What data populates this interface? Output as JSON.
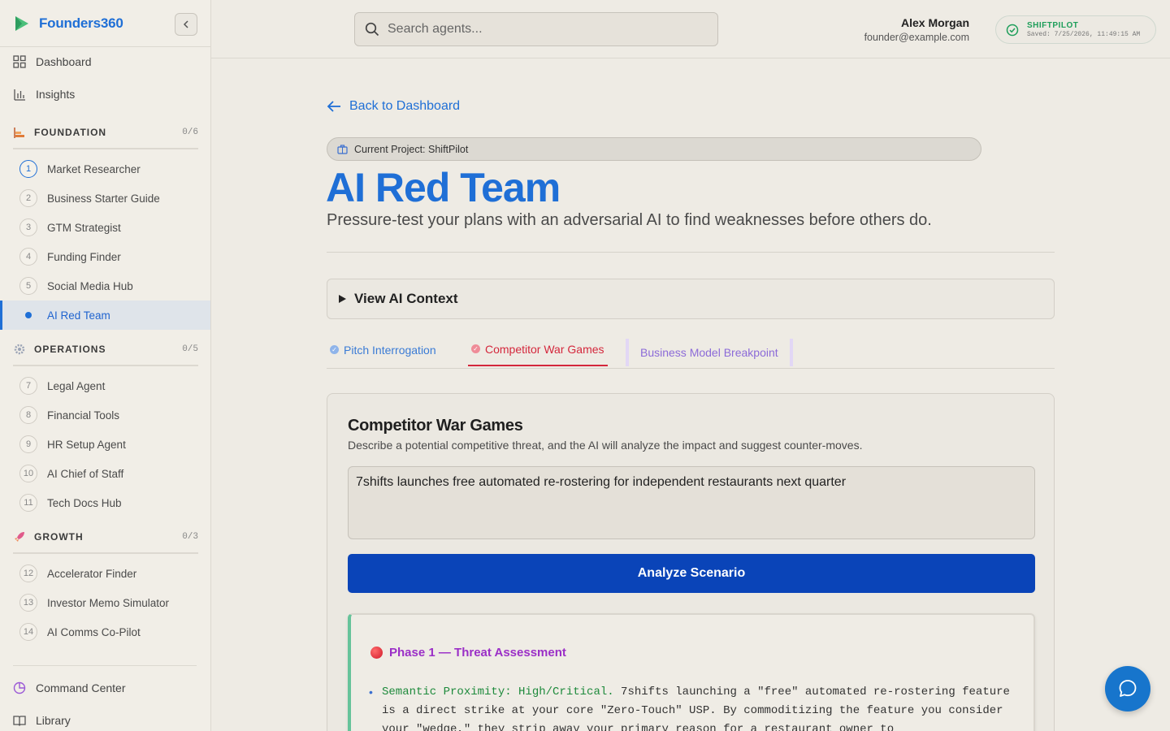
{
  "brand": {
    "name": "Founders360"
  },
  "nav_top": [
    {
      "label": "Dashboard",
      "icon": "grid-icon"
    },
    {
      "label": "Insights",
      "icon": "bar-chart-icon"
    }
  ],
  "sections": {
    "foundation": {
      "title": "FOUNDATION",
      "count": "0/6",
      "items": [
        {
          "num": "1",
          "label": "Market Researcher"
        },
        {
          "num": "2",
          "label": "Business Starter Guide"
        },
        {
          "num": "3",
          "label": "GTM Strategist"
        },
        {
          "num": "4",
          "label": "Funding Finder"
        },
        {
          "num": "5",
          "label": "Social Media Hub"
        },
        {
          "num": "",
          "label": "AI Red Team"
        }
      ]
    },
    "operations": {
      "title": "OPERATIONS",
      "count": "0/5",
      "items": [
        {
          "num": "7",
          "label": "Legal Agent"
        },
        {
          "num": "8",
          "label": "Financial Tools"
        },
        {
          "num": "9",
          "label": "HR Setup Agent"
        },
        {
          "num": "10",
          "label": "AI Chief of Staff"
        },
        {
          "num": "11",
          "label": "Tech Docs Hub"
        }
      ]
    },
    "growth": {
      "title": "GROWTH",
      "count": "0/3",
      "items": [
        {
          "num": "12",
          "label": "Accelerator Finder"
        },
        {
          "num": "13",
          "label": "Investor Memo Simulator"
        },
        {
          "num": "14",
          "label": "AI Comms Co-Pilot"
        }
      ]
    }
  },
  "nav_bottom": [
    {
      "label": "Command Center",
      "icon": "pie-chart-icon"
    },
    {
      "label": "Library",
      "icon": "book-icon"
    }
  ],
  "header": {
    "search_placeholder": "Search agents...",
    "user_name": "Alex Morgan",
    "user_email": "founder@example.com",
    "project_badge": "SHIFTPILOT",
    "saved_text": "Saved: 7/25/2026, 11:49:15 AM"
  },
  "main": {
    "back_label": "Back to Dashboard",
    "project_label": "Current Project: ShiftPilot",
    "title": "AI Red Team",
    "subtitle": "Pressure-test your plans with an adversarial AI to find weaknesses before others do.",
    "context_label": "View AI Context",
    "tabs": [
      {
        "label": "Pitch Interrogation"
      },
      {
        "label": "Competitor War Games"
      },
      {
        "label": "Business Model Breakpoint"
      }
    ],
    "card": {
      "title": "Competitor War Games",
      "description": "Describe a potential competitive threat, and the AI will analyze the impact and suggest counter-moves.",
      "scenario_value": "7shifts launches free automated re-rostering for independent restaurants next quarter",
      "button_label": "Analyze Scenario",
      "phase_title": "Phase 1 — Threat Assessment",
      "bullet_highlight": "Semantic Proximity: High/Critical.",
      "bullet_text": " 7shifts launching a \"free\" automated re-rostering feature is a direct strike at your core \"Zero-Touch\" USP. By commoditizing the feature you consider your \"wedge,\" they strip away your primary reason for a restaurant owner to"
    }
  },
  "colors": {
    "accent": "#1f6fd6",
    "button": "#0a44b8",
    "danger": "#d4273c",
    "purple": "#8c6bd8",
    "success": "#1e9e5a"
  }
}
